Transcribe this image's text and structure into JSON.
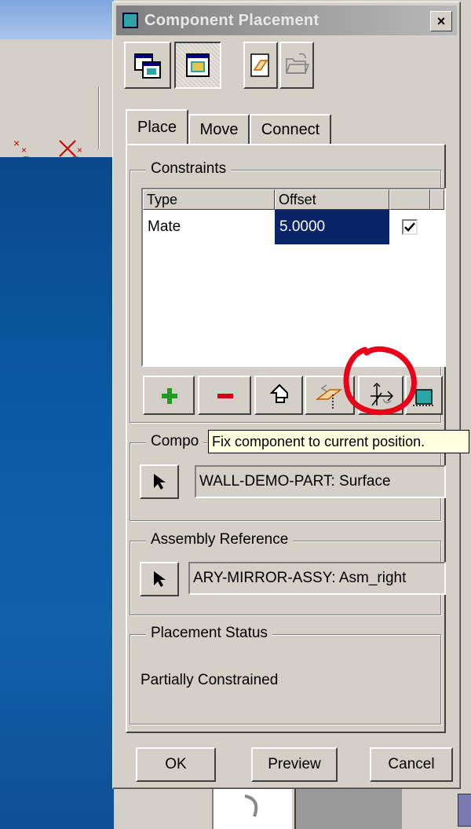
{
  "dialog": {
    "title": "Component Placement",
    "close_label": "×"
  },
  "tabs": [
    {
      "label": "Place",
      "active": true
    },
    {
      "label": "Move",
      "active": false
    },
    {
      "label": "Connect",
      "active": false
    }
  ],
  "constraints": {
    "group_label": "Constraints",
    "columns": [
      "Type",
      "Offset"
    ],
    "rows": [
      {
        "type": "Mate",
        "offset": "5.0000",
        "enabled": true
      }
    ]
  },
  "tooltip": "Fix component to current position.",
  "component_reference": {
    "group_label": "Compo",
    "value": "WALL-DEMO-PART: Surface"
  },
  "assembly_reference": {
    "group_label": "Assembly Reference",
    "value": "ARY-MIRROR-ASSY: Asm_right"
  },
  "placement_status": {
    "group_label": "Placement Status",
    "value": "Partially Constrained"
  },
  "buttons": {
    "ok": "OK",
    "preview": "Preview",
    "cancel": "Cancel"
  },
  "colors": {
    "selection": "#0a246a",
    "tooltip_bg": "#ffffe1",
    "annotation": "#e8001a"
  }
}
